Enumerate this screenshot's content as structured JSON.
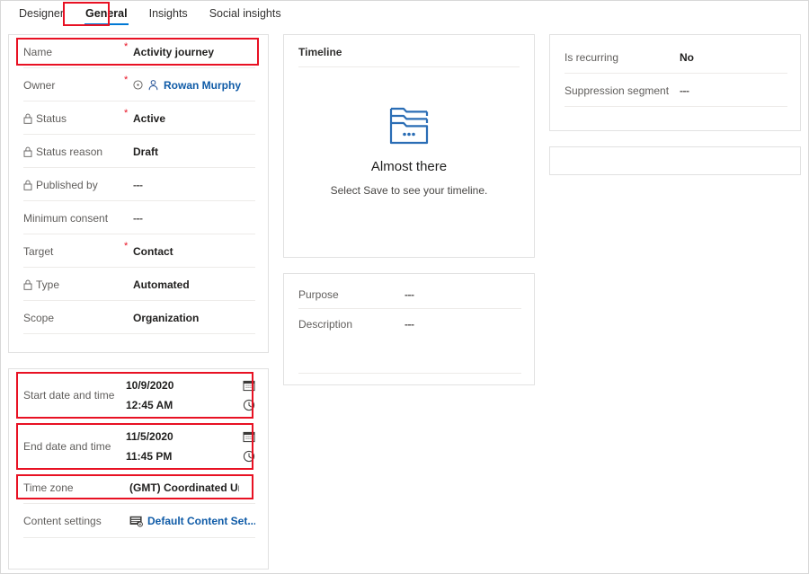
{
  "tabs": [
    {
      "label": "Designer",
      "active": false
    },
    {
      "label": "General",
      "active": true
    },
    {
      "label": "Insights",
      "active": false
    },
    {
      "label": "Social insights",
      "active": false
    }
  ],
  "left_column": {
    "main_card": {
      "fields": [
        {
          "label": "Name",
          "required": true,
          "value": "Activity journey",
          "locked": false,
          "style": "bold",
          "highlight": true
        },
        {
          "label": "Owner",
          "required": true,
          "value": "Rowan Murphy",
          "locked": false,
          "style": "link",
          "highlight": false
        },
        {
          "label": "Status",
          "required": true,
          "value": "Active",
          "locked": true,
          "style": "bold",
          "highlight": false
        },
        {
          "label": "Status reason",
          "required": false,
          "value": "Draft",
          "locked": true,
          "style": "bold",
          "highlight": false
        },
        {
          "label": "Published by",
          "required": false,
          "value": "---",
          "locked": true,
          "style": "muted",
          "highlight": false
        },
        {
          "label": "Minimum consent",
          "required": false,
          "value": "---",
          "locked": false,
          "style": "muted",
          "highlight": false
        },
        {
          "label": "Target",
          "required": true,
          "value": "Contact",
          "locked": false,
          "style": "bold",
          "highlight": false
        },
        {
          "label": "Type",
          "required": false,
          "value": "Automated",
          "locked": true,
          "style": "bold",
          "highlight": false
        },
        {
          "label": "Scope",
          "required": false,
          "value": "Organization",
          "locked": false,
          "style": "bold",
          "highlight": false
        }
      ]
    },
    "schedule_card": {
      "start": {
        "label": "Start date and time",
        "date": "10/9/2020",
        "time": "12:45 AM"
      },
      "end": {
        "label": "End date and time",
        "date": "11/5/2020",
        "time": "11:45 PM"
      },
      "timezone": {
        "label": "Time zone",
        "value": "(GMT) Coordinated Universal Time"
      },
      "content_settings": {
        "label": "Content settings",
        "value": "Default Content Set..."
      }
    }
  },
  "middle_column": {
    "timeline": {
      "header": "Timeline",
      "empty_title": "Almost there",
      "empty_subtitle": "Select Save to see your timeline."
    },
    "details_card": {
      "fields": [
        {
          "label": "Purpose",
          "value": "---"
        },
        {
          "label": "Description",
          "value": "---"
        }
      ]
    }
  },
  "right_column": {
    "recurring_card": {
      "fields": [
        {
          "label": "Is recurring",
          "value": "No"
        },
        {
          "label": "Suppression segment",
          "value": "---"
        }
      ]
    }
  },
  "colors": {
    "accent": "#0078d4",
    "link": "#0f5ba7",
    "highlight": "#e81123",
    "required": "#e81123",
    "label": "#605e5c",
    "border": "#e1e1e1"
  }
}
